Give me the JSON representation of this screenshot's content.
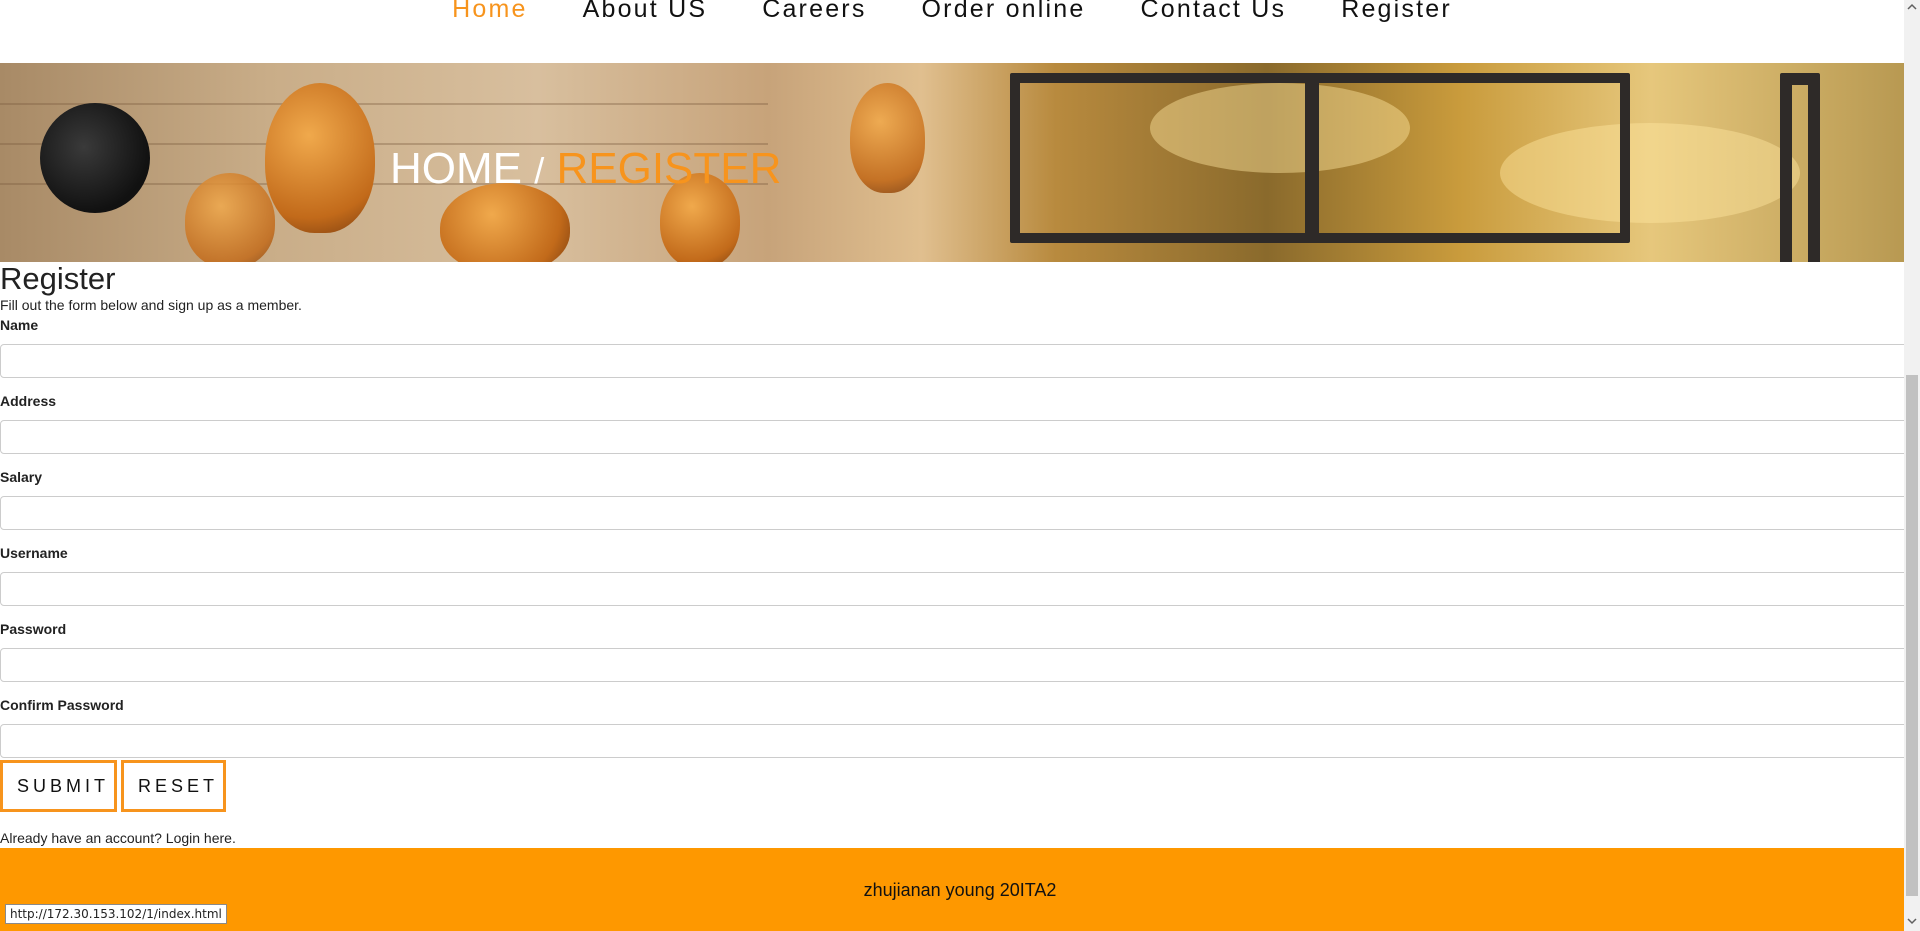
{
  "nav": {
    "items": [
      {
        "label": "Home",
        "active": true
      },
      {
        "label": "About US",
        "active": false
      },
      {
        "label": "Careers",
        "active": false
      },
      {
        "label": "Order online",
        "active": false
      },
      {
        "label": "Contact Us",
        "active": false
      },
      {
        "label": "Register",
        "active": false
      }
    ]
  },
  "hero": {
    "home": "HOME",
    "separator": "/",
    "current": "REGISTER"
  },
  "register": {
    "title": "Register",
    "subtitle": "Fill out the form below and sign up as a member.",
    "fields": [
      {
        "label": "Name",
        "value": ""
      },
      {
        "label": "Address",
        "value": ""
      },
      {
        "label": "Salary",
        "value": ""
      },
      {
        "label": "Username",
        "value": ""
      },
      {
        "label": "Password",
        "value": ""
      },
      {
        "label": "Confirm Password",
        "value": ""
      }
    ],
    "submit_label": "SUBMIT",
    "reset_label": "RESET",
    "login_prompt": "Already have an account?",
    "login_link": "Login here."
  },
  "footer": {
    "text": "zhujianan young 20ITA2"
  },
  "status_url": "http://172.30.153.102/1/index.html",
  "colors": {
    "accent": "#f7941d",
    "footer": "#fe9800"
  },
  "icons": {
    "scroll_up": "chevron-up-icon",
    "scroll_down": "chevron-down-icon"
  }
}
